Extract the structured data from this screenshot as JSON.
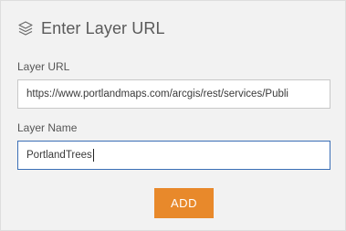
{
  "header": {
    "icon": "layers-icon",
    "title": "Enter Layer URL"
  },
  "form": {
    "url_label": "Layer URL",
    "url_value": "https://www.portlandmaps.com/arcgis/rest/services/Publi",
    "name_label": "Layer Name",
    "name_value": "PortlandTrees"
  },
  "actions": {
    "add_label": "ADD"
  },
  "colors": {
    "panel_bg": "#f2f2f2",
    "accent": "#e8892b",
    "focus_border": "#3b6fb6"
  }
}
